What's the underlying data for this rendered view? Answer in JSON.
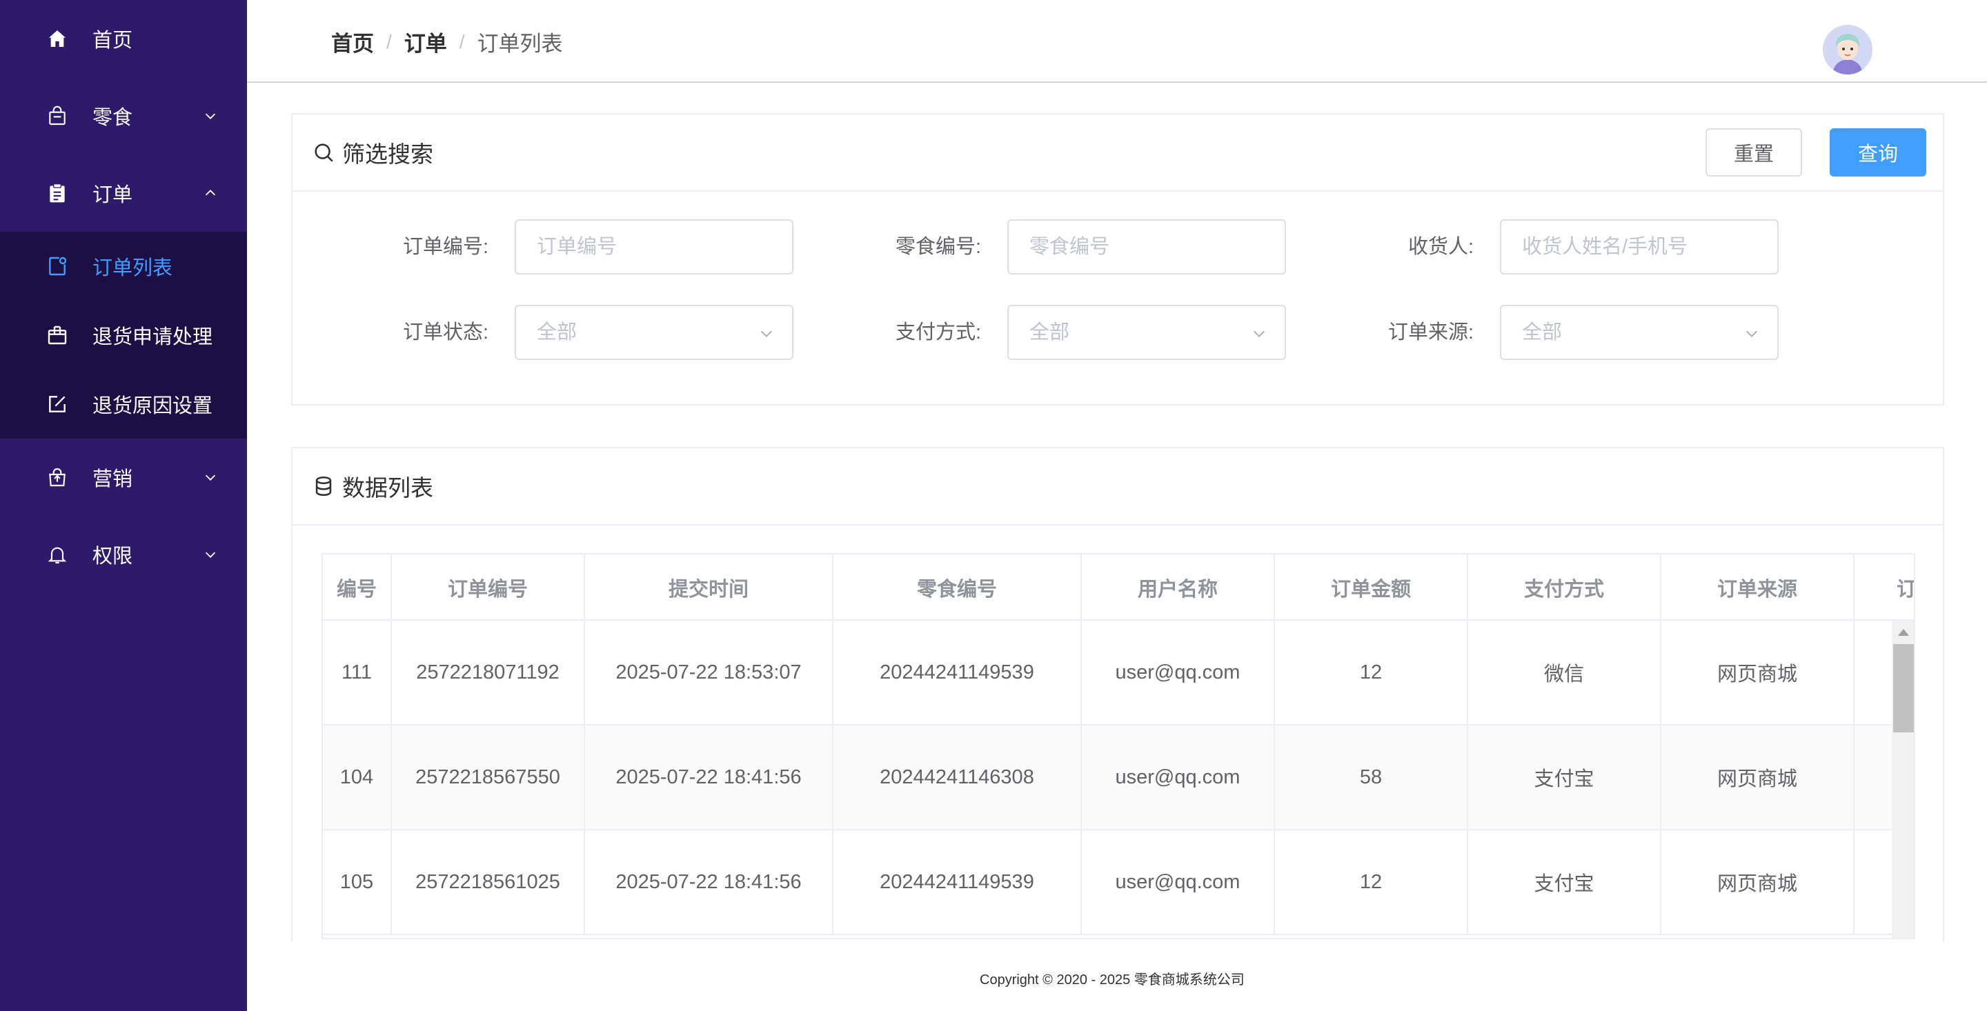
{
  "sidebar": {
    "items": [
      {
        "label": "首页",
        "icon": "home-icon"
      },
      {
        "label": "零食",
        "icon": "bag-icon"
      },
      {
        "label": "订单",
        "icon": "clipboard-icon"
      },
      {
        "label": "营销",
        "icon": "promotion-icon"
      },
      {
        "label": "权限",
        "icon": "bell-icon"
      }
    ],
    "submenu": [
      {
        "label": "订单列表",
        "icon": "order-list-icon",
        "active": true
      },
      {
        "label": "退货申请处理",
        "icon": "return-box-icon"
      },
      {
        "label": "退货原因设置",
        "icon": "edit-icon"
      }
    ],
    "active_color": "#409eff",
    "background": "#2e1a6b"
  },
  "header": {
    "breadcrumb": [
      "首页",
      "订单",
      "订单列表"
    ],
    "separator": "/"
  },
  "filter": {
    "title": "筛选搜索",
    "reset_label": "重置",
    "query_label": "查询",
    "fields": {
      "order_no": {
        "label": "订单编号:",
        "placeholder": "订单编号"
      },
      "snack_no": {
        "label": "零食编号:",
        "placeholder": "零食编号"
      },
      "receiver": {
        "label": "收货人:",
        "placeholder": "收货人姓名/手机号"
      },
      "status": {
        "label": "订单状态:",
        "value": "全部"
      },
      "pay_method": {
        "label": "支付方式:",
        "value": "全部"
      },
      "source": {
        "label": "订单来源:",
        "value": "全部"
      }
    }
  },
  "list": {
    "title": "数据列表",
    "columns": [
      "编号",
      "订单编号",
      "提交时间",
      "零食编号",
      "用户名称",
      "订单金额",
      "支付方式",
      "订单来源",
      "订"
    ],
    "rows": [
      [
        "111",
        "2572218071192",
        "2025-07-22 18:53:07",
        "20244241149539",
        "user@qq.com",
        "12",
        "微信",
        "网页商城",
        ""
      ],
      [
        "104",
        "2572218567550",
        "2025-07-22 18:41:56",
        "20244241146308",
        "user@qq.com",
        "58",
        "支付宝",
        "网页商城",
        ""
      ],
      [
        "105",
        "2572218561025",
        "2025-07-22 18:41:56",
        "20244241149539",
        "user@qq.com",
        "12",
        "支付宝",
        "网页商城",
        ""
      ]
    ]
  },
  "footer": {
    "copyright": "Copyright © 2020 - 2025   零食商城系统公司"
  },
  "colors": {
    "primary": "#409eff",
    "sidebar": "#2e1a6b",
    "submenu": "#1c0f44"
  }
}
